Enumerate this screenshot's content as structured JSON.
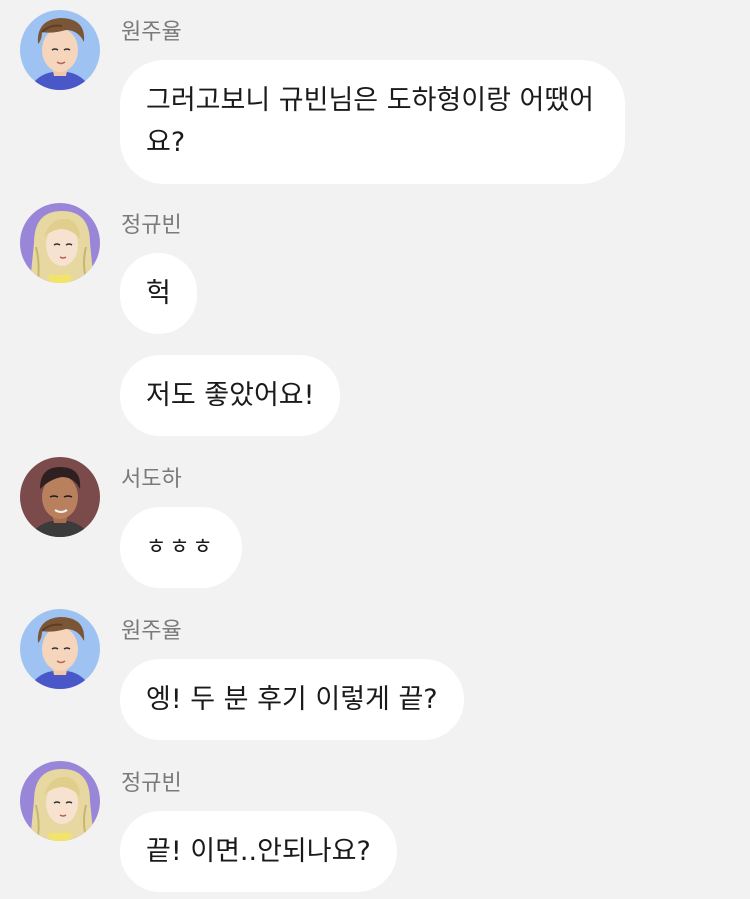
{
  "colors": {
    "background": "#f2f2f2",
    "bubble": "#ffffff",
    "sender_name": "#7a7a7a",
    "text": "#1a1a1a"
  },
  "messages": [
    {
      "sender": "원주율",
      "avatar": "avatar-juyul-icon",
      "bubbles": [
        "그러고보니 규빈님은 도하형이랑 어땠어요?"
      ]
    },
    {
      "sender": "정규빈",
      "avatar": "avatar-gyubin-icon",
      "bubbles": [
        "헉",
        "저도 좋았어요!"
      ]
    },
    {
      "sender": "서도하",
      "avatar": "avatar-doha-icon",
      "bubbles": [
        "ㅎㅎㅎ"
      ]
    },
    {
      "sender": "원주율",
      "avatar": "avatar-juyul-icon",
      "bubbles": [
        "엥! 두 분 후기 이렇게 끝?"
      ]
    },
    {
      "sender": "정규빈",
      "avatar": "avatar-gyubin-icon",
      "bubbles": [
        "끝! 이면..안되나요?"
      ]
    }
  ]
}
